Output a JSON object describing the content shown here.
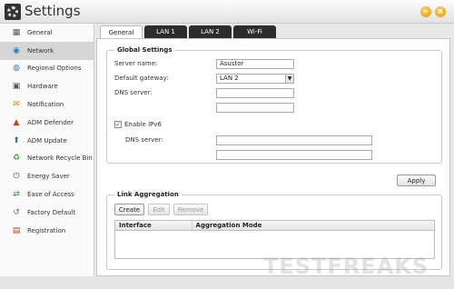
{
  "window": {
    "title": "Settings"
  },
  "sidebar": {
    "items": [
      {
        "label": "General",
        "icon": "general-icon"
      },
      {
        "label": "Network",
        "icon": "network-globe-icon"
      },
      {
        "label": "Regional Options",
        "icon": "globe-clock-icon"
      },
      {
        "label": "Hardware",
        "icon": "hardware-icon"
      },
      {
        "label": "Notification",
        "icon": "notification-icon"
      },
      {
        "label": "ADM Defender",
        "icon": "shield-warning-icon"
      },
      {
        "label": "ADM Update",
        "icon": "update-arrow-icon"
      },
      {
        "label": "Network Recycle Bin",
        "icon": "recycle-bin-icon"
      },
      {
        "label": "Energy Saver",
        "icon": "energy-icon"
      },
      {
        "label": "Ease of Access",
        "icon": "ease-access-icon"
      },
      {
        "label": "Factory Default",
        "icon": "factory-default-icon"
      },
      {
        "label": "Registration",
        "icon": "registration-icon"
      }
    ]
  },
  "tabs": [
    {
      "label": "General"
    },
    {
      "label": "LAN 1"
    },
    {
      "label": "LAN 2"
    },
    {
      "label": "Wi-Fi"
    }
  ],
  "global": {
    "title": "Global Settings",
    "server_name_label": "Server name:",
    "server_name_value": "Asustor",
    "gateway_label": "Default gateway:",
    "gateway_value": "LAN 2",
    "dns_label": "DNS server:",
    "dns1_value": "",
    "dns2_value": "",
    "ipv6_label": "Enable IPv6",
    "ipv6_checked": true,
    "ipv6_dns_label": "DNS server:",
    "ipv6_dns1_value": "",
    "ipv6_dns2_value": ""
  },
  "apply_label": "Apply",
  "aggregation": {
    "title": "Link Aggregation",
    "create_label": "Create",
    "edit_label": "Edit",
    "remove_label": "Remove",
    "columns": [
      "Interface",
      "Aggregation Mode"
    ]
  },
  "watermark": "TESTFREAKS"
}
